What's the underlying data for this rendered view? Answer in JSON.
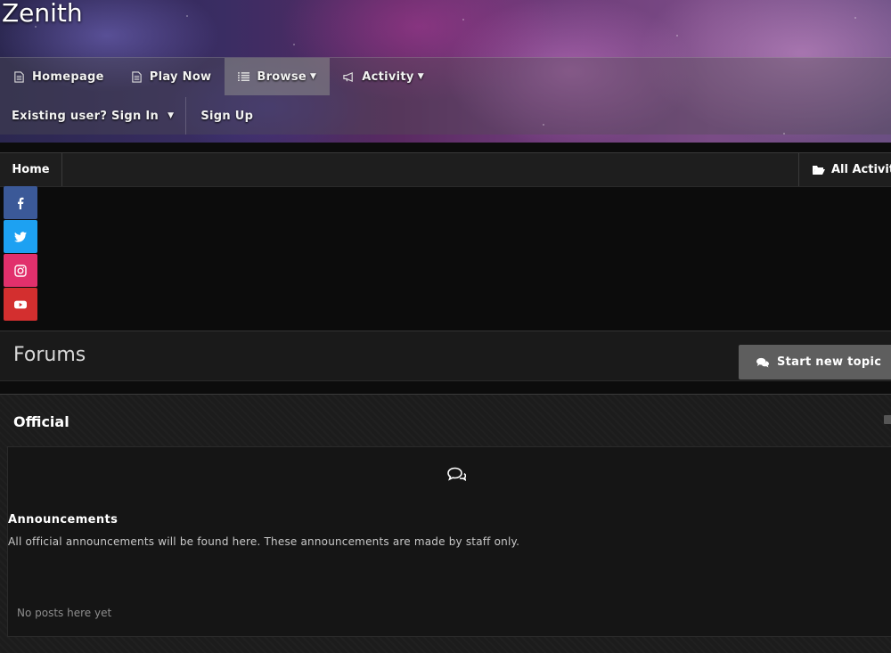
{
  "site": {
    "title": "Zenith"
  },
  "nav": {
    "items": [
      {
        "label": "Homepage",
        "icon": "document-icon"
      },
      {
        "label": "Play Now",
        "icon": "document-icon"
      },
      {
        "label": "Browse",
        "icon": "list-icon",
        "active": true
      },
      {
        "label": "Activity",
        "icon": "megaphone-icon"
      }
    ],
    "signin_label": "Existing user? Sign In",
    "signup_label": "Sign Up"
  },
  "breadcrumb": {
    "home_label": "Home",
    "all_activity_label": "All Activity"
  },
  "social": [
    {
      "name": "facebook",
      "icon": "facebook-icon",
      "color": "#3b5998"
    },
    {
      "name": "twitter",
      "icon": "twitter-icon",
      "color": "#1da1f2"
    },
    {
      "name": "instagram",
      "icon": "instagram-icon",
      "color": "#e1306c"
    },
    {
      "name": "youtube",
      "icon": "youtube-icon",
      "color": "#d32f2f"
    }
  ],
  "page": {
    "title": "Forums",
    "new_topic_label": "Start new topic"
  },
  "category": {
    "title": "Official",
    "forums": [
      {
        "name": "Announcements",
        "description": "All official announcements will be found here. These announcements are made by staff only.",
        "stats": "No posts here yet"
      }
    ]
  }
}
